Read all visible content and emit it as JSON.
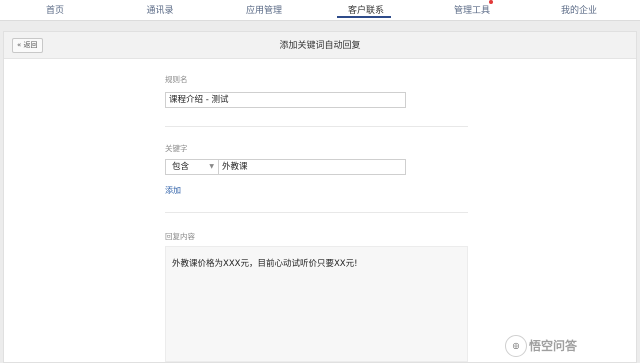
{
  "nav": {
    "items": [
      "首页",
      "通讯录",
      "应用管理",
      "客户联系",
      "管理工具",
      "我的企业"
    ],
    "active": "客户联系"
  },
  "panel": {
    "back_label": "« 返回",
    "title": "添加关键词自动回复"
  },
  "form": {
    "rule_name_label": "规则名",
    "rule_name_value": "课程介绍 - 测试",
    "keyword_label": "关键字",
    "match_mode": "包含",
    "keyword_value": "外教课",
    "add_label": "添加",
    "reply_label": "回复内容",
    "reply_value": "外教课价格为XXX元，目前心动试听价只要XX元!"
  },
  "watermark": {
    "text": "悟空问答"
  },
  "colors": {
    "accent": "#2e4b8a",
    "link": "#2d5fa8",
    "notify": "#e23a3a"
  }
}
